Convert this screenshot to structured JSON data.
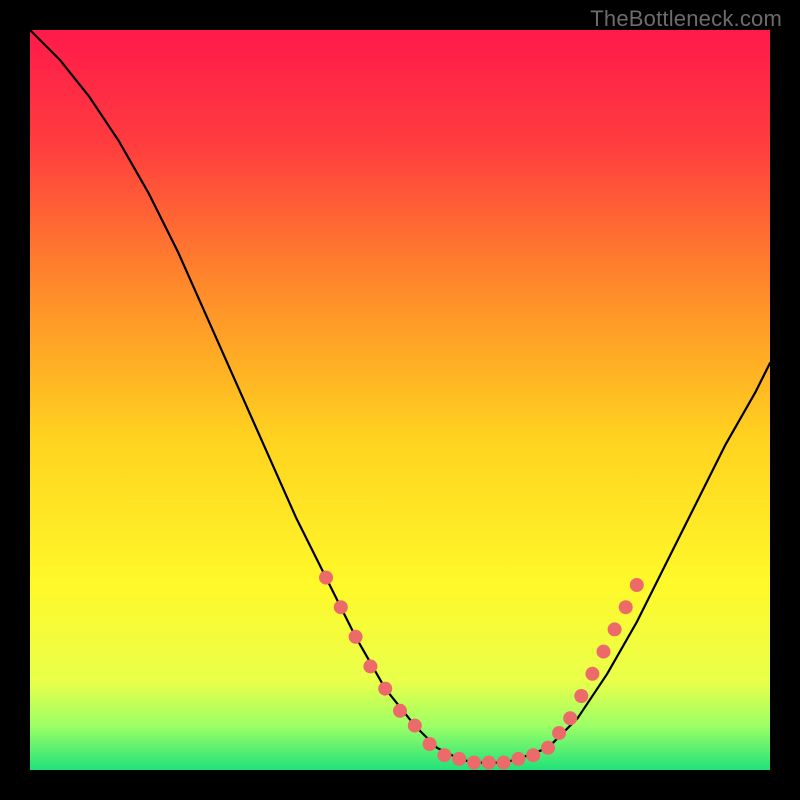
{
  "watermark": "TheBottleneck.com",
  "chart_data": {
    "type": "line",
    "title": "",
    "xlabel": "",
    "ylabel": "",
    "xlim": [
      0,
      100
    ],
    "ylim": [
      0,
      100
    ],
    "grid": false,
    "legend": false,
    "gradient": {
      "stops": [
        {
          "offset": 0.0,
          "color": "#ff1a4b"
        },
        {
          "offset": 0.15,
          "color": "#ff3b3f"
        },
        {
          "offset": 0.35,
          "color": "#ff8b2a"
        },
        {
          "offset": 0.55,
          "color": "#ffd21f"
        },
        {
          "offset": 0.75,
          "color": "#fff92a"
        },
        {
          "offset": 0.88,
          "color": "#e9ff4a"
        },
        {
          "offset": 0.94,
          "color": "#9dff66"
        },
        {
          "offset": 1.0,
          "color": "#20e27a"
        }
      ]
    },
    "curve": {
      "x": [
        0,
        4,
        8,
        12,
        16,
        20,
        24,
        28,
        32,
        36,
        40,
        44,
        48,
        52,
        55,
        58,
        60,
        62,
        64,
        66,
        70,
        74,
        78,
        82,
        86,
        90,
        94,
        98,
        100
      ],
      "y": [
        100,
        96,
        91,
        85,
        78,
        70,
        61,
        52,
        43,
        34,
        26,
        18,
        11,
        6,
        3,
        1.5,
        1,
        1,
        1,
        1.5,
        3,
        7,
        13,
        20,
        28,
        36,
        44,
        51,
        55
      ]
    },
    "flat_segment": {
      "x_start": 55,
      "x_end": 68,
      "y": 1
    },
    "markers": {
      "color": "#ec6a6a",
      "radius_px": 7,
      "points": [
        {
          "x": 40,
          "y": 26
        },
        {
          "x": 42,
          "y": 22
        },
        {
          "x": 44,
          "y": 18
        },
        {
          "x": 46,
          "y": 14
        },
        {
          "x": 48,
          "y": 11
        },
        {
          "x": 50,
          "y": 8
        },
        {
          "x": 52,
          "y": 6
        },
        {
          "x": 54,
          "y": 3.5
        },
        {
          "x": 56,
          "y": 2
        },
        {
          "x": 58,
          "y": 1.5
        },
        {
          "x": 60,
          "y": 1
        },
        {
          "x": 62,
          "y": 1
        },
        {
          "x": 64,
          "y": 1
        },
        {
          "x": 66,
          "y": 1.5
        },
        {
          "x": 68,
          "y": 2
        },
        {
          "x": 70,
          "y": 3
        },
        {
          "x": 71.5,
          "y": 5
        },
        {
          "x": 73,
          "y": 7
        },
        {
          "x": 74.5,
          "y": 10
        },
        {
          "x": 76,
          "y": 13
        },
        {
          "x": 77.5,
          "y": 16
        },
        {
          "x": 79,
          "y": 19
        },
        {
          "x": 80.5,
          "y": 22
        },
        {
          "x": 82,
          "y": 25
        }
      ]
    }
  }
}
